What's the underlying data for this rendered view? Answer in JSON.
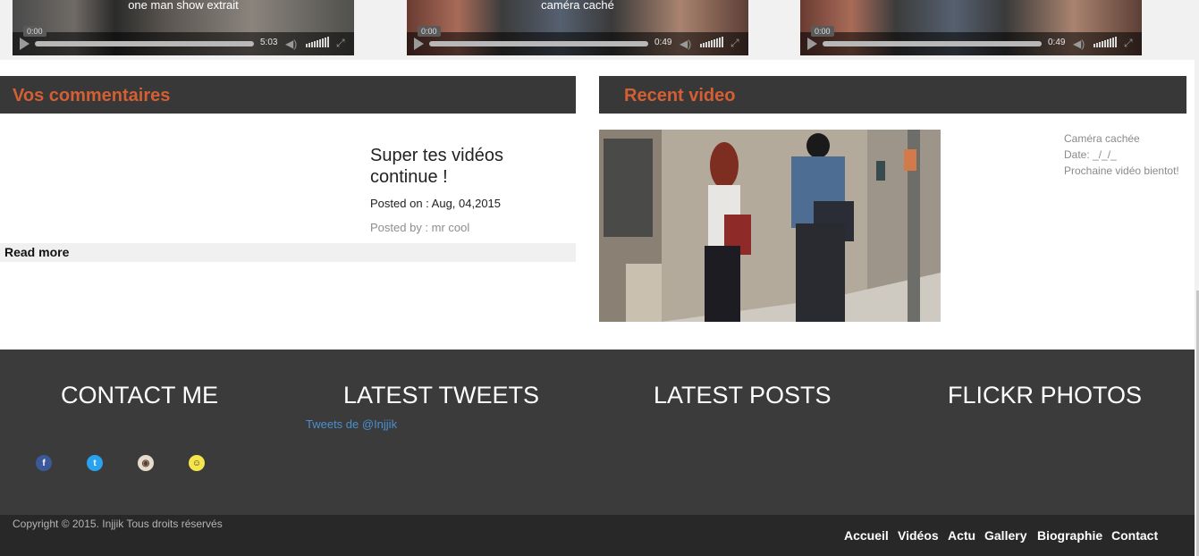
{
  "videos": [
    {
      "title": "one man show extrait",
      "current_time": "0:00",
      "duration": "5:03"
    },
    {
      "title": "caméra caché",
      "current_time": "0:00",
      "duration": "0:49"
    },
    {
      "title": "",
      "current_time": "0:00",
      "duration": "0:49"
    }
  ],
  "comments": {
    "header": "Vos commentaires",
    "title": "Super tes vidéos continue !",
    "posted_on": "Posted on : Aug, 04,2015",
    "posted_by": "Posted by : mr cool",
    "read_more": "Read more"
  },
  "recent_video": {
    "header": "Recent video",
    "name": "Caméra cachée",
    "date": "Date: _/_/_",
    "note": "Prochaine vidéo bientot!"
  },
  "footer": {
    "contact_title": "CONTACT ME",
    "tweets_title": "LATEST TWEETS",
    "posts_title": "LATEST POSTS",
    "flickr_title": "FLICKR PHOTOS",
    "tweets_link": "Tweets de @Injjik",
    "social_icons": [
      "facebook-icon",
      "twitter-icon",
      "instagram-icon",
      "snapchat-icon"
    ]
  },
  "bottom": {
    "copyright": "Copyright © 2015. Injjik Tous droits réservés",
    "nav": [
      "Accueil",
      "Vidéos",
      "Actu",
      "Gallery",
      "Biographie",
      "Contact"
    ]
  },
  "colors": {
    "accent": "#d35f33",
    "header_bg": "#383838",
    "footer_bg": "#3b3b3b",
    "bottom_bg": "#282828",
    "link": "#4a8fd0"
  }
}
